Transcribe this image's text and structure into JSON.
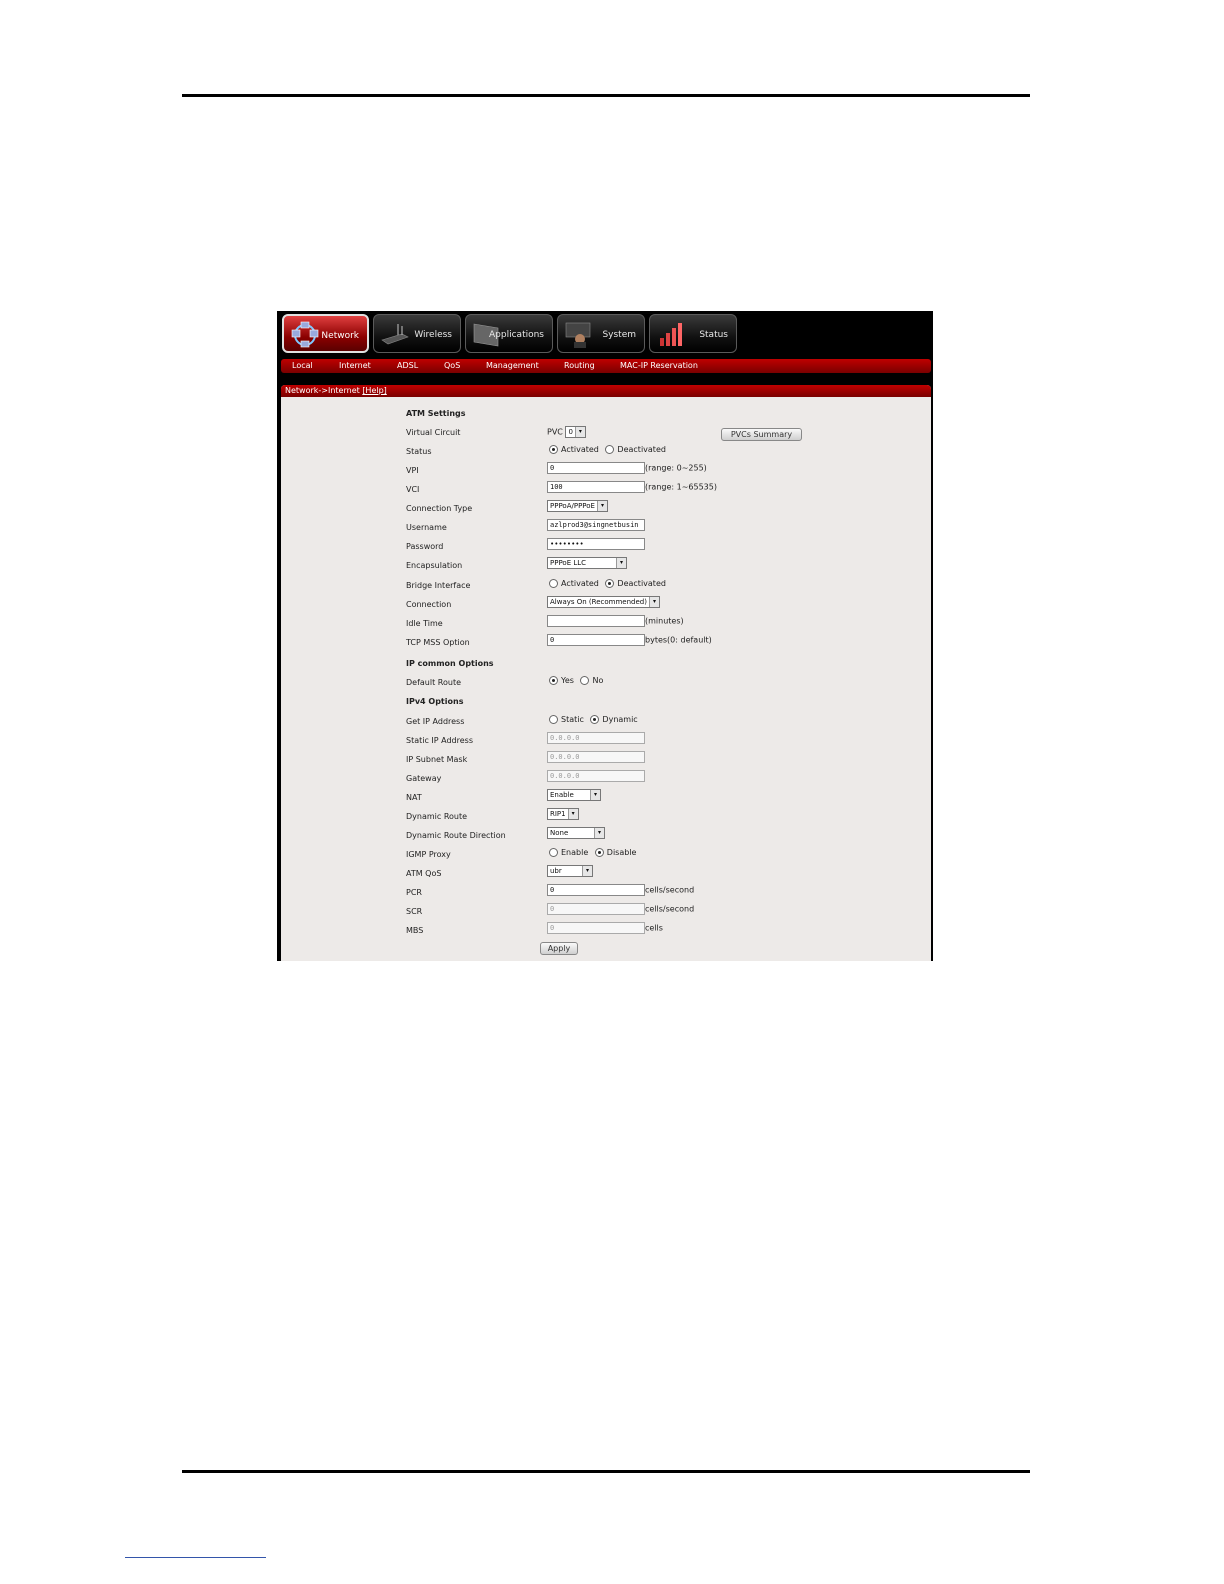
{
  "nav": {
    "tabs": [
      {
        "label": "Network",
        "icon": "network-icon"
      },
      {
        "label": "Wireless",
        "icon": "router-icon"
      },
      {
        "label": "Applications",
        "icon": "applications-icon"
      },
      {
        "label": "System",
        "icon": "system-icon"
      },
      {
        "label": "Status",
        "icon": "status-chart-icon"
      }
    ],
    "subtabs": [
      "Local",
      "Internet",
      "ADSL",
      "QoS",
      "Management",
      "Routing",
      "MAC-IP Reservation"
    ]
  },
  "breadcrumb": {
    "path": "Network->Internet ",
    "help": "[Help]"
  },
  "form": {
    "atm_heading": "ATM Settings",
    "virtual_circuit": {
      "label": "Virtual Circuit",
      "pvc_label": "PVC",
      "pvc_value": "0",
      "summary_button": "PVCs Summary"
    },
    "status": {
      "label": "Status",
      "opt1": "Activated",
      "opt2": "Deactivated",
      "selected": "Activated"
    },
    "vpi": {
      "label": "VPI",
      "value": "0",
      "hint": "(range: 0~255)"
    },
    "vci": {
      "label": "VCI",
      "value": "100",
      "hint": "(range: 1~65535)"
    },
    "connection_type": {
      "label": "Connection Type",
      "value": "PPPoA/PPPoE"
    },
    "username": {
      "label": "Username",
      "value": "azlprod3@singnetbusin"
    },
    "password": {
      "label": "Password",
      "value": "••••••••"
    },
    "encapsulation": {
      "label": "Encapsulation",
      "value": "PPPoE LLC"
    },
    "bridge_interface": {
      "label": "Bridge Interface",
      "opt1": "Activated",
      "opt2": "Deactivated",
      "selected": "Deactivated"
    },
    "connection": {
      "label": "Connection",
      "value": "Always On (Recommended)"
    },
    "idle_time": {
      "label": "Idle Time",
      "value": "",
      "hint": "(minutes)"
    },
    "tcp_mss": {
      "label": "TCP MSS Option",
      "value": "0",
      "hint": "bytes(0: default)"
    },
    "ip_common_heading": "IP common Options",
    "default_route": {
      "label": "Default Route",
      "opt1": "Yes",
      "opt2": "No",
      "selected": "Yes"
    },
    "ipv4_heading": "IPv4 Options",
    "get_ip": {
      "label": "Get IP Address",
      "opt1": "Static",
      "opt2": "Dynamic",
      "selected": "Dynamic"
    },
    "static_ip": {
      "label": "Static IP Address",
      "value": "0.0.0.0"
    },
    "subnet_mask": {
      "label": "IP Subnet Mask",
      "value": "0.0.0.0"
    },
    "gateway": {
      "label": "Gateway",
      "value": "0.0.0.0"
    },
    "nat": {
      "label": "NAT",
      "value": "Enable"
    },
    "dynamic_route": {
      "label": "Dynamic Route",
      "value": "RIP1"
    },
    "dynamic_route_direction": {
      "label": "Dynamic Route Direction",
      "value": "None"
    },
    "igmp_proxy": {
      "label": "IGMP Proxy",
      "opt1": "Enable",
      "opt2": "Disable",
      "selected": "Disable"
    },
    "atm_qos": {
      "label": "ATM QoS",
      "value": "ubr"
    },
    "pcr": {
      "label": "PCR",
      "value": "0",
      "hint": "cells/second"
    },
    "scr": {
      "label": "SCR",
      "value": "0",
      "hint": "cells/second"
    },
    "mbs": {
      "label": "MBS",
      "value": "0",
      "hint": "cells"
    },
    "apply_button": "Apply"
  },
  "colors": {
    "accent": "#c00000",
    "panel": "#edeae8",
    "nav_bg": "#000000"
  }
}
